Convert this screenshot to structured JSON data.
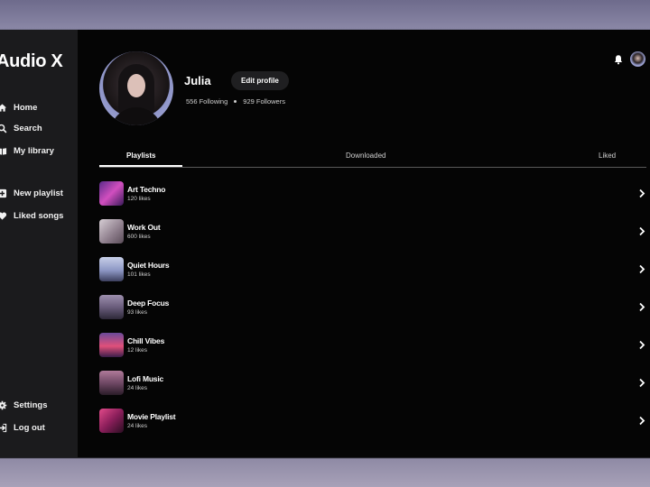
{
  "app": {
    "title": "Audio X"
  },
  "sidebar": {
    "items": [
      {
        "label": "Home",
        "icon": "home-icon"
      },
      {
        "label": "Search",
        "icon": "search-icon"
      },
      {
        "label": "My library",
        "icon": "library-icon"
      },
      {
        "label": "New playlist",
        "icon": "plus-square-icon"
      },
      {
        "label": "Liked songs",
        "icon": "heart-icon"
      },
      {
        "label": "Settings",
        "icon": "gear-icon"
      },
      {
        "label": "Log out",
        "icon": "logout-icon"
      }
    ]
  },
  "header": {
    "bell_icon": "bell-icon",
    "avatar": "user-avatar"
  },
  "profile": {
    "name": "Julia",
    "edit_label": "Edit profile",
    "following": "556 Following",
    "followers": "929 Followers"
  },
  "tabs": [
    {
      "label": "Playlists",
      "active": true
    },
    {
      "label": "Downloaded",
      "active": false
    },
    {
      "label": "Liked",
      "active": false
    }
  ],
  "playlists": [
    {
      "title": "Art Techno",
      "likes": "120 likes",
      "color": "#d14fbf"
    },
    {
      "title": "Work Out",
      "likes": "600 likes",
      "color": "#b9a8b7"
    },
    {
      "title": "Quiet Hours",
      "likes": "101 likes",
      "color": "#9aa6c8"
    },
    {
      "title": "Deep Focus",
      "likes": "93 likes",
      "color": "#7b6e8a"
    },
    {
      "title": "Chill Vibes",
      "likes": "12 likes",
      "color": "#e0507a"
    },
    {
      "title": "Lofi Music",
      "likes": "24 likes",
      "color": "#8a5e79"
    },
    {
      "title": "Movie Playlist",
      "likes": "24 likes",
      "color": "#c0387a"
    }
  ]
}
